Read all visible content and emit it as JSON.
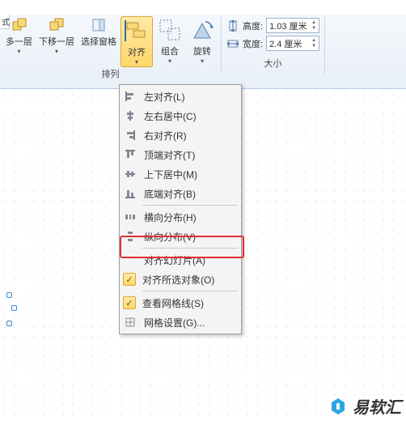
{
  "tab_fragment": "式",
  "groups": {
    "arrange": {
      "label": "排列",
      "buttons": {
        "bring_forward": "多一层",
        "send_backward": "下移一层",
        "selection_pane": "选择窗格",
        "align": "对齐",
        "group": "组合",
        "rotate": "旋转"
      }
    },
    "size": {
      "label": "大小",
      "height_label": "高度:",
      "height_value": "1.03 厘米",
      "width_label": "宽度:",
      "width_value": "2.4 厘米"
    }
  },
  "align_menu": {
    "items": [
      {
        "key": "align-left",
        "label": "左对齐(L)"
      },
      {
        "key": "align-center-h",
        "label": "左右居中(C)"
      },
      {
        "key": "align-right",
        "label": "右对齐(R)"
      },
      {
        "key": "align-top",
        "label": "顶端对齐(T)"
      },
      {
        "key": "align-middle-v",
        "label": "上下居中(M)"
      },
      {
        "key": "align-bottom",
        "label": "底端对齐(B)"
      },
      {
        "key": "distribute-h",
        "label": "横向分布(H)"
      },
      {
        "key": "distribute-v",
        "label": "纵向分布(V)"
      },
      {
        "key": "align-to-slide",
        "label": "对齐幻灯片(A)"
      },
      {
        "key": "align-selected",
        "label": "对齐所选对象(O)",
        "checked": true
      },
      {
        "key": "view-gridlines",
        "label": "查看网格线(S)",
        "checked": true
      },
      {
        "key": "grid-settings",
        "label": "网格设置(G)..."
      }
    ],
    "separators_after": [
      5,
      7,
      9
    ]
  },
  "watermark": "易软汇"
}
